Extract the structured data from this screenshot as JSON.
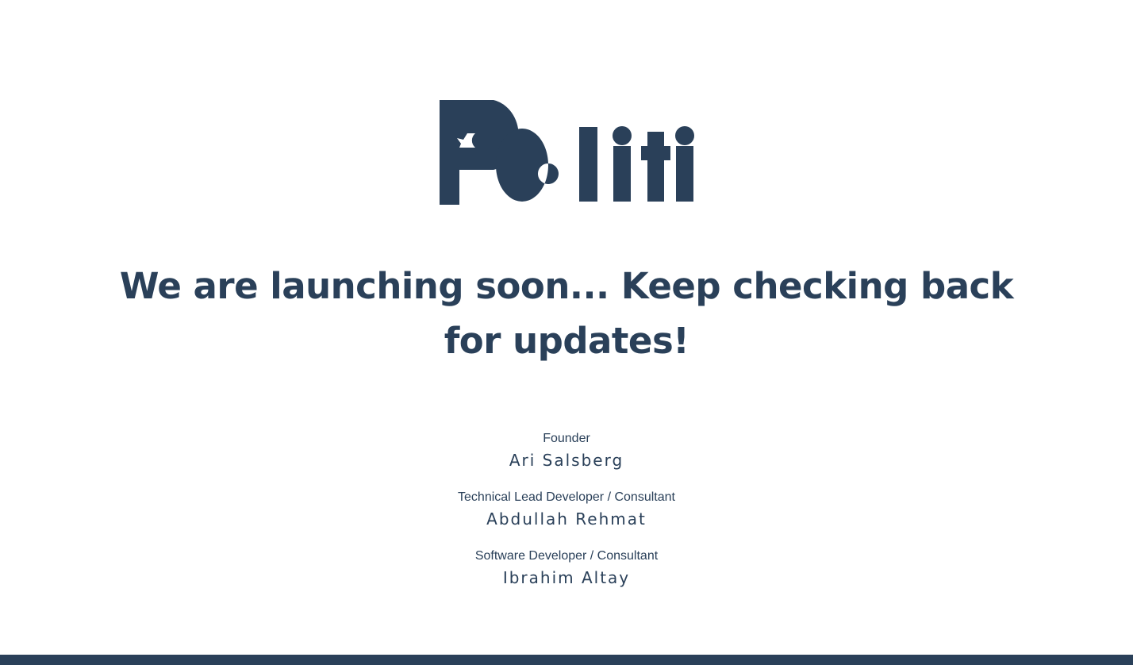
{
  "brand": {
    "logo_text": "Politi",
    "color": "#2a4059"
  },
  "headline": "We are launching soon... Keep checking back for updates!",
  "team": [
    {
      "role": "Founder",
      "name": "Ari Salsberg"
    },
    {
      "role": "Technical Lead Developer / Consultant",
      "name": "Abdullah Rehmat"
    },
    {
      "role": "Software Developer / Consultant",
      "name": "Ibrahim Altay"
    }
  ],
  "footer": {
    "color": "#2a4059"
  }
}
